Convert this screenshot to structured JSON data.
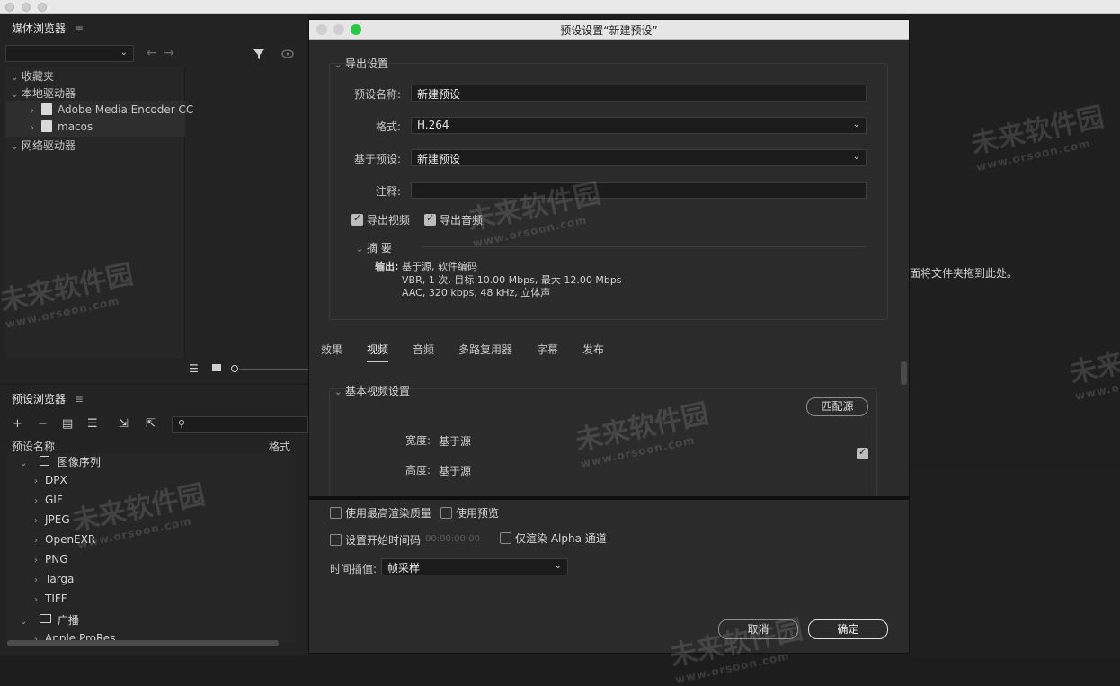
{
  "media_browser": {
    "title": "媒体浏览器",
    "menu": "≡",
    "tree": {
      "favorites": "收藏夹",
      "local_drives": "本地驱动器",
      "drives": [
        "Adobe Media Encoder CC",
        "macos"
      ],
      "network_drives": "网络驱动器"
    }
  },
  "preset_browser": {
    "title": "预设浏览器",
    "menu": "≡",
    "col_name": "预设名称",
    "col_format": "格式",
    "image_sequence": "图像序列",
    "formats": [
      "DPX",
      "GIF",
      "JPEG",
      "OpenEXR",
      "PNG",
      "Targa",
      "TIFF"
    ],
    "broadcast": "广播",
    "partial_item": "Apple ProRes"
  },
  "drop_hint": "面将文件夹拖到此处。",
  "dialog": {
    "title": "预设设置“新建预设”",
    "export_settings": {
      "heading": "导出设置",
      "preset_name_label": "预设名称:",
      "preset_name_value": "新建预设",
      "format_label": "格式:",
      "format_value": "H.264",
      "based_on_label": "基于预设:",
      "based_on_value": "新建预设",
      "comment_label": "注释:",
      "comment_value": "",
      "export_video": "导出视频",
      "export_audio": "导出音频",
      "summary_heading": "摘 要",
      "output_label": "输出:",
      "output_line1": "基于源, 软件编码",
      "output_line2": "VBR, 1 次, 目标 10.00 Mbps, 最大 12.00 Mbps",
      "output_line3": "AAC, 320 kbps, 48 kHz, 立体声"
    },
    "tabs": [
      "效果",
      "视频",
      "音频",
      "多路复用器",
      "字幕",
      "发布"
    ],
    "active_tab": "视频",
    "basic_video": {
      "heading": "基本视频设置",
      "match_source": "匹配源",
      "width_label": "宽度:",
      "width_value": "基于源",
      "height_label": "高度:",
      "height_value": "基于源"
    },
    "bottom": {
      "max_render_quality": "使用最高渲染质量",
      "use_previews": "使用预览",
      "set_start_timecode": "设置开始时间码",
      "timecode_value": "00:00:00:00",
      "render_alpha_only": "仅渲染 Alpha 通道",
      "time_interp_label": "时间插值:",
      "time_interp_value": "帧采样",
      "cancel": "取消",
      "ok": "确定"
    }
  },
  "watermark": {
    "brand": "未来软件园",
    "url": "www.orsoon.com"
  },
  "colors": {
    "panel_bg": "#232323",
    "dialog_bg": "#2b2b2b",
    "traffic_red": "#ff5f57",
    "traffic_yellow": "#febc2e",
    "traffic_green": "#28c840"
  }
}
